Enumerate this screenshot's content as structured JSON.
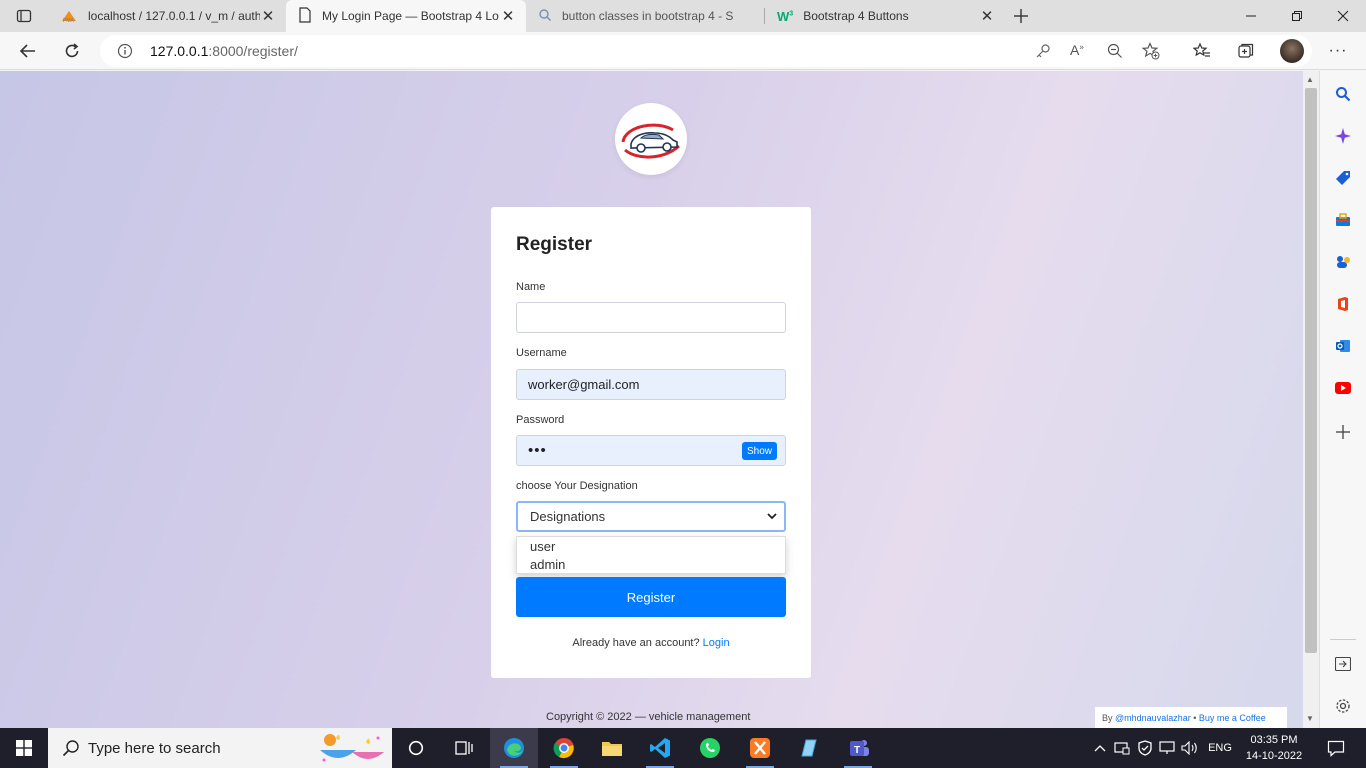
{
  "browser": {
    "tabs": [
      {
        "title": "localhost / 127.0.0.1 / v_m / auth",
        "icon": "phpmyadmin-icon",
        "active": false
      },
      {
        "title": "My Login Page — Bootstrap 4 Lo",
        "icon": "page-icon",
        "active": true
      },
      {
        "title": "button classes in bootstrap 4 - S",
        "icon": "search-icon",
        "active": false
      },
      {
        "title": "Bootstrap 4 Buttons",
        "icon": "w3schools-icon",
        "active": false
      }
    ],
    "url_host": "127.0.0.1",
    "url_path": ":8000/register/"
  },
  "page": {
    "form": {
      "title": "Register",
      "name_label": "Name",
      "name_value": "",
      "username_label": "Username",
      "username_value": "worker@gmail.com",
      "password_label": "Password",
      "password_value": "•••",
      "show_label": "Show",
      "designation_label": "choose Your Designation",
      "designation_selected": "Designations",
      "designation_options": [
        "user",
        "admin"
      ],
      "register_label": "Register",
      "already_text": "Already have an account?",
      "login_link": "Login"
    },
    "footer": "Copyright © 2022 — vehicle management",
    "credit_by": "By",
    "credit_author": "@mhdnauvalazhar",
    "credit_sep": "•",
    "credit_coffee": "Buy me a Coffee"
  },
  "taskbar": {
    "search_placeholder": "Type here to search",
    "lang": "ENG",
    "time": "03:35 PM",
    "date": "14-10-2022"
  },
  "colors": {
    "primary": "#007bff",
    "autofill": "#e8f0fe"
  }
}
